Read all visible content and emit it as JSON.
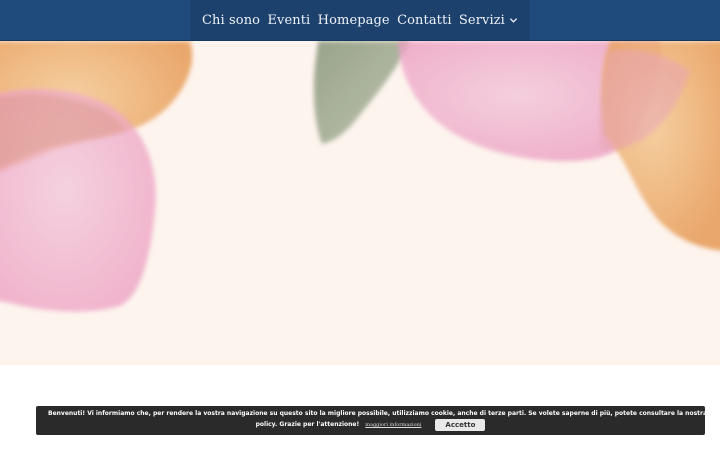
{
  "nav": {
    "items": [
      {
        "label": "Chi sono"
      },
      {
        "label": "Eventi"
      },
      {
        "label": "Homepage"
      },
      {
        "label": "Contatti"
      },
      {
        "label": "Servizi",
        "icon": "chevron-down-icon"
      }
    ]
  },
  "cookie_banner": {
    "text_line1": "Benvenuti! Vi informiamo che, per rendere la vostra navigazione su questo sito la migliore possibile, utilizziamo cookie, anche di terze parti. Se volete saperne di più, potete consultare la nostra privacy",
    "text_line2": "policy. Grazie per l'attenzione!",
    "more_link": "maggiori informazioni",
    "accept_label": "Accetto"
  },
  "colors": {
    "topbar": "#1f4a7c",
    "hero_background": "#fdf4ee",
    "watercolor_pink": "#f1b9d2",
    "watercolor_orange": "#efb176",
    "watercolor_green": "#a3ad95",
    "banner": "#2a2a2a"
  }
}
